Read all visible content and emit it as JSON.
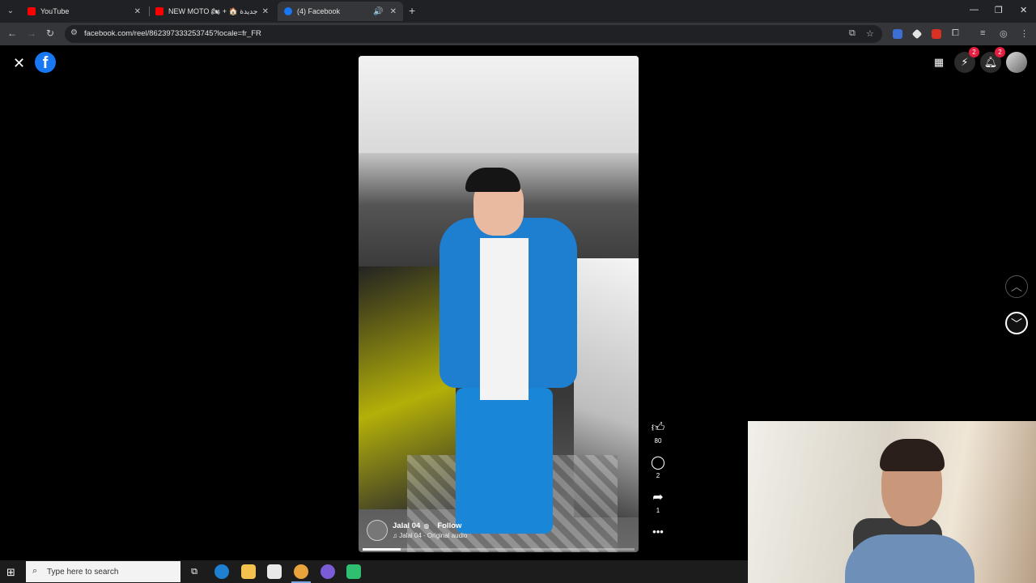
{
  "browser": {
    "tabs": [
      {
        "title": "YouTube",
        "favicon": "youtube-favicon",
        "color": "#ff0000"
      },
      {
        "title": "NEW MOTO 🏍 + 🏠 دار جديدة",
        "favicon": "youtube-favicon",
        "color": "#ff0000"
      },
      {
        "title": "(4) Facebook",
        "favicon": "facebook-favicon",
        "color": "#1877f2",
        "active": true,
        "audio": true
      }
    ],
    "url": "facebook.com/reel/862397333253745?locale=fr_FR",
    "window_controls": [
      "minimize",
      "restore",
      "close"
    ]
  },
  "facebook": {
    "logo": "f",
    "reel": {
      "author": "Jalal 04",
      "follow_label": "Follow",
      "audio_label": "Jalal 04 · Original audio",
      "progress": 0.14
    },
    "actions": {
      "likes": "80",
      "comments": "2",
      "shares": "1"
    },
    "badges": {
      "messenger": "2",
      "notifications": "2"
    }
  },
  "taskbar": {
    "search_placeholder": "Type here to search"
  },
  "colors": {
    "facebook_blue": "#1877f2",
    "badge_red": "#e41e3f",
    "chrome_dark": "#202124"
  }
}
